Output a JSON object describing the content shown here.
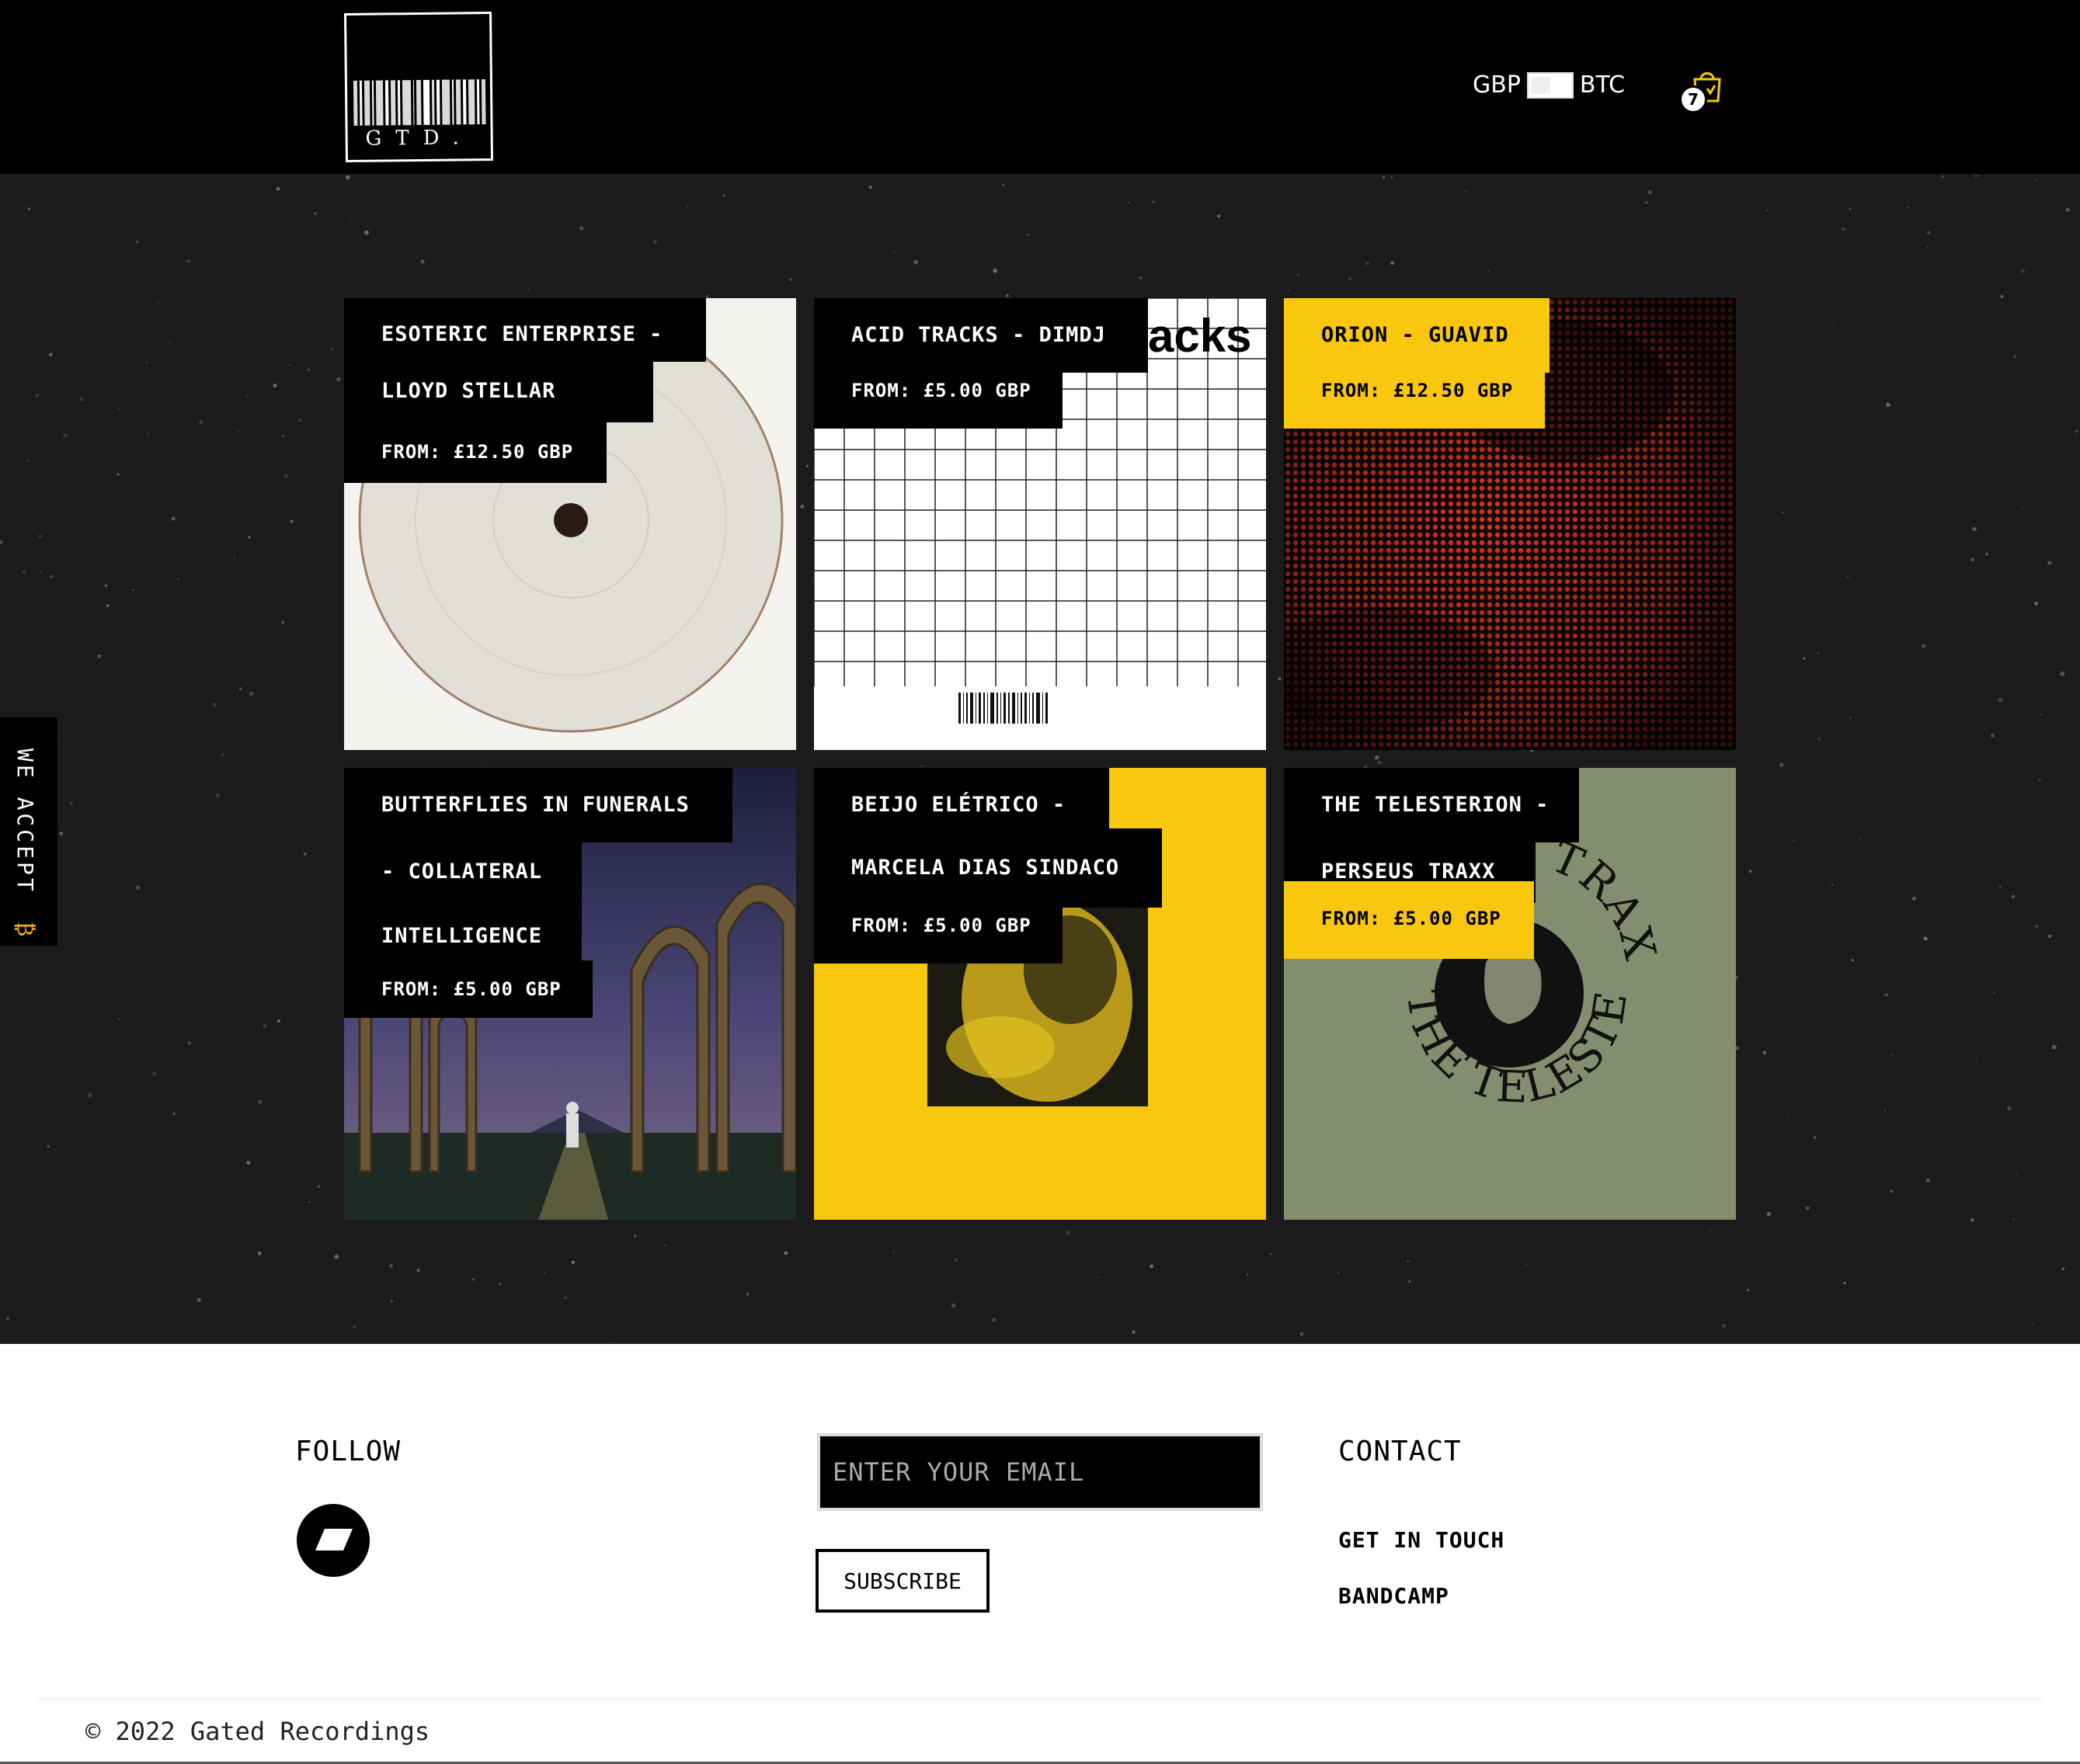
{
  "header": {
    "logo_text": "GTD.",
    "currency_left": "GBP",
    "currency_right": "BTC",
    "cart_count": "7"
  },
  "sidebar": {
    "we_accept": "WE ACCEPT",
    "btc_symbol": "₿"
  },
  "products": [
    {
      "title_lines": [
        "ESOTERIC ENTERPRISE -",
        "LLOYD STELLAR"
      ],
      "price": "FROM: £12.50 GBP",
      "tag_style": "black",
      "cover": "white-vinyl"
    },
    {
      "title_lines": [
        "ACID TRACKS - DIMDJ"
      ],
      "price": "FROM: £5.00 GBP",
      "tag_style": "black",
      "cover": "grid",
      "cover_text": "acks"
    },
    {
      "title_lines": [
        "ORION - GUAVID"
      ],
      "price": "FROM: £12.50 GBP",
      "tag_style": "yellow",
      "cover": "red-halftone"
    },
    {
      "title_lines": [
        "BUTTERFLIES IN FUNERALS",
        "- COLLATERAL",
        "INTELLIGENCE"
      ],
      "price": "FROM: £5.00 GBP",
      "tag_style": "black",
      "cover": "night-ruins"
    },
    {
      "title_lines": [
        "BEIJO ELÉTRICO -",
        "MARCELA DIAS SINDACO"
      ],
      "price": "FROM: £5.00 GBP",
      "tag_style": "black",
      "cover": "yellow-frame"
    },
    {
      "title_lines": [
        "THE TELESTERION -",
        "PERSEUS TRAXX"
      ],
      "price": "FROM: £5.00 GBP",
      "tag_style": "mixed",
      "cover": "green-circle",
      "cover_text": "THE TELESTERION",
      "cover_text_top": "TRAXX"
    }
  ],
  "footer": {
    "follow_heading": "FOLLOW",
    "social_icon": "bandcamp-icon",
    "email_placeholder": "ENTER YOUR EMAIL",
    "subscribe_label": "SUBSCRIBE",
    "contact_heading": "CONTACT",
    "contact_links": [
      "GET IN TOUCH",
      "BANDCAMP"
    ],
    "copyright": "© 2022 Gated Recordings"
  },
  "colors": {
    "accent": "#f9c80e",
    "background_dark": "#1b1b1b",
    "header": "#000000",
    "green_cover": "#848d6e",
    "red_cover": "#d8341f"
  }
}
